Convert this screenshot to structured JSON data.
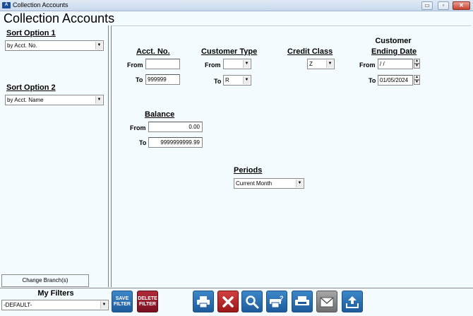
{
  "window": {
    "title": "Collection Accounts",
    "minimize": "▭",
    "restore": "▫",
    "close": "✕",
    "app_icon": "aim-icon"
  },
  "app_title": "Collection Accounts",
  "left": {
    "sort1": {
      "label": "Sort Option 1",
      "value": "by Acct. No."
    },
    "sort2": {
      "label": "Sort Option 2",
      "value": "by Acct. Name"
    },
    "change_branch": "Change Branch(s)",
    "my_filters": {
      "label": "My Filters",
      "value": "-DEFAULT-"
    }
  },
  "acct_no": {
    "label": "Acct. No.",
    "from_label": "From",
    "from": "",
    "to_label": "To",
    "to": "999999"
  },
  "customer_type": {
    "label": "Customer Type",
    "from_label": "From",
    "from": "",
    "to_label": "To",
    "to": "R"
  },
  "credit_class": {
    "label": "Credit Class",
    "value": "Z"
  },
  "cust_end_date": {
    "label_line1": "Customer",
    "label_line2": "Ending Date",
    "from_label": "From",
    "from": " / /",
    "to_label": "To",
    "to": "01/05/2024"
  },
  "balance": {
    "label": "Balance",
    "from_label": "From",
    "from": "0.00",
    "to_label": "To",
    "to": "9999999999.99"
  },
  "periods": {
    "label": "Periods",
    "value": "Current Month"
  },
  "toolbar": {
    "save_filter": "SAVE FILTER",
    "delete_filter": "DELETE FILTER"
  }
}
